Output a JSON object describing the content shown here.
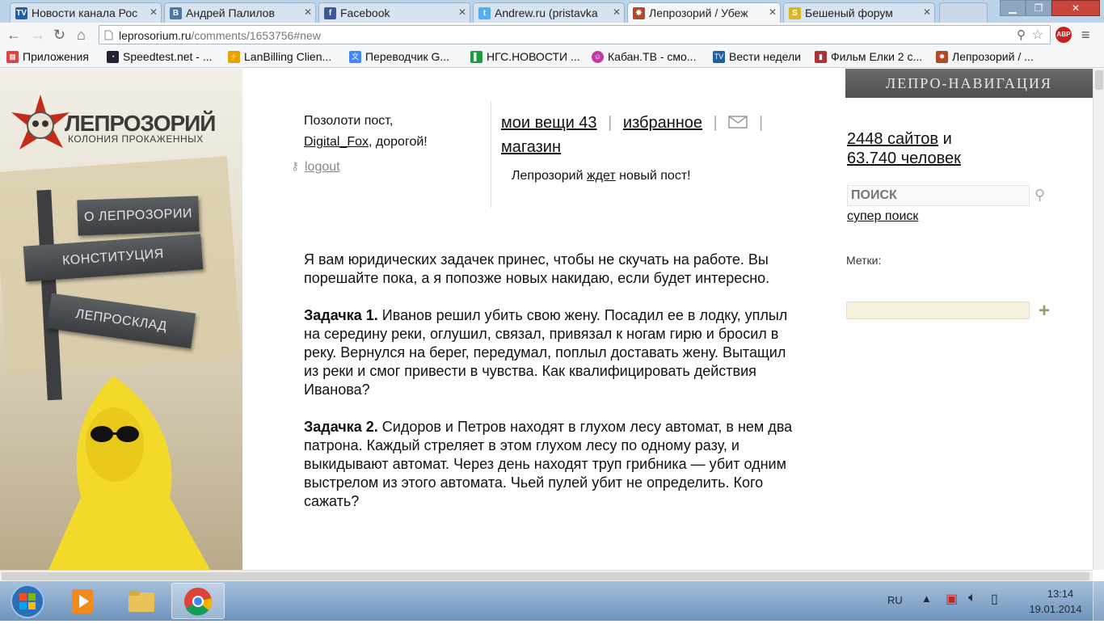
{
  "browser": {
    "tabs": [
      {
        "label": "Новости канала Рос",
        "icon": "tv-icon",
        "color": "#1f5fa8",
        "glyph": "TV"
      },
      {
        "label": "Андрей Палилов",
        "icon": "vk-icon",
        "color": "#4a76a8",
        "glyph": "B"
      },
      {
        "label": "Facebook",
        "icon": "facebook-icon",
        "color": "#3b5998",
        "glyph": "f"
      },
      {
        "label": "Andrew.ru (pristavka",
        "icon": "twitter-icon",
        "color": "#55acee",
        "glyph": "t"
      },
      {
        "label": "Лепрозорий / Убеж",
        "icon": "lepro-icon",
        "color": "#b0482a",
        "glyph": "✸"
      },
      {
        "label": "Бешеный форум",
        "icon": "forum-icon",
        "color": "#d9b827",
        "glyph": "S"
      }
    ],
    "url_host": "leprosorium.ru",
    "url_path": "/comments/1653756#new",
    "abp_label": "ABP",
    "bookmarks": [
      {
        "label": "Приложения",
        "icon": "apps-icon",
        "color": "#d44"
      },
      {
        "label": "Speedtest.net - ...",
        "icon": "speedtest-icon",
        "color": "#223"
      },
      {
        "label": "LanBilling Clien...",
        "icon": "lanbilling-icon",
        "color": "#e6a100"
      },
      {
        "label": "Переводчик G...",
        "icon": "translate-icon",
        "color": "#4285f4"
      },
      {
        "label": "НГС.НОВОСТИ ...",
        "icon": "ngs-icon",
        "color": "#1c9c3c"
      },
      {
        "label": "Кабан.ТВ - смо...",
        "icon": "kaban-icon",
        "color": "#c03aa8"
      },
      {
        "label": "Вести недели",
        "icon": "vesti-icon",
        "color": "#1f5fa8"
      },
      {
        "label": "Фильм Елки 2 с...",
        "icon": "film-icon",
        "color": "#a33"
      },
      {
        "label": "Лепрозорий / ...",
        "icon": "lepro-bookmark-icon",
        "color": "#b0482a"
      }
    ]
  },
  "site": {
    "logo_title": "ЛЕПРОЗОРИЙ",
    "logo_subtitle": "КОЛОНИЯ ПРОКАЖЕННЫХ",
    "nav_signs": [
      "О ЛЕПРОЗОРИИ",
      "КОНСТИТУЦИЯ",
      "ЛЕПРОСКЛАД"
    ],
    "gild_text": "Позолоти пост,",
    "gild_user": "Digital_Fox",
    "gild_suffix": ", дорогой!",
    "logout": "logout",
    "menu": {
      "my_things": "мои вещи 43",
      "favorites": "избранное",
      "shop": "магазин",
      "sep": "|"
    },
    "wait_prefix": "Лепрозорий ",
    "wait_link": "ждет",
    "wait_suffix": " новый пост!",
    "right": {
      "nav_header": "ЛЕПРО-НАВИГАЦИЯ",
      "sites": "2448 сайтов",
      "and": " и",
      "people": "63.740 человек",
      "search_placeholder": "поиск",
      "super_search": "супер поиск",
      "tags_label": "Метки:",
      "add_tag": "+"
    }
  },
  "post": {
    "intro": "Я вам юридических задачек принес, чтобы не скучать на работе. Вы порешайте пока, а я попозже новых накидаю, если будет интересно.",
    "task1_title": "Задачка 1.",
    "task1_text": " Иванов решил убить свою жену. Посадил ее в лодку, уплыл на середину реки, оглушил, связал, привязал к ногам гирю и бросил в реку. Вернулся на берег, передумал, поплыл доставать жену. Вытащил из реки и смог привести в чувства. Как квалифицировать действия Иванова?",
    "task2_title": "Задачка 2.",
    "task2_text": " Сидоров и Петров находят в глухом лесу автомат, в нем два патрона. Каждый стреляет в этом глухом лесу по одному разу, и выкидывают автомат. Через день находят труп грибника — убит одним выстрелом из этого автомата. Чьей пулей убит не определить. Кого сажать?"
  },
  "taskbar": {
    "lang": "RU",
    "time": "13:14",
    "date": "19.01.2014"
  }
}
